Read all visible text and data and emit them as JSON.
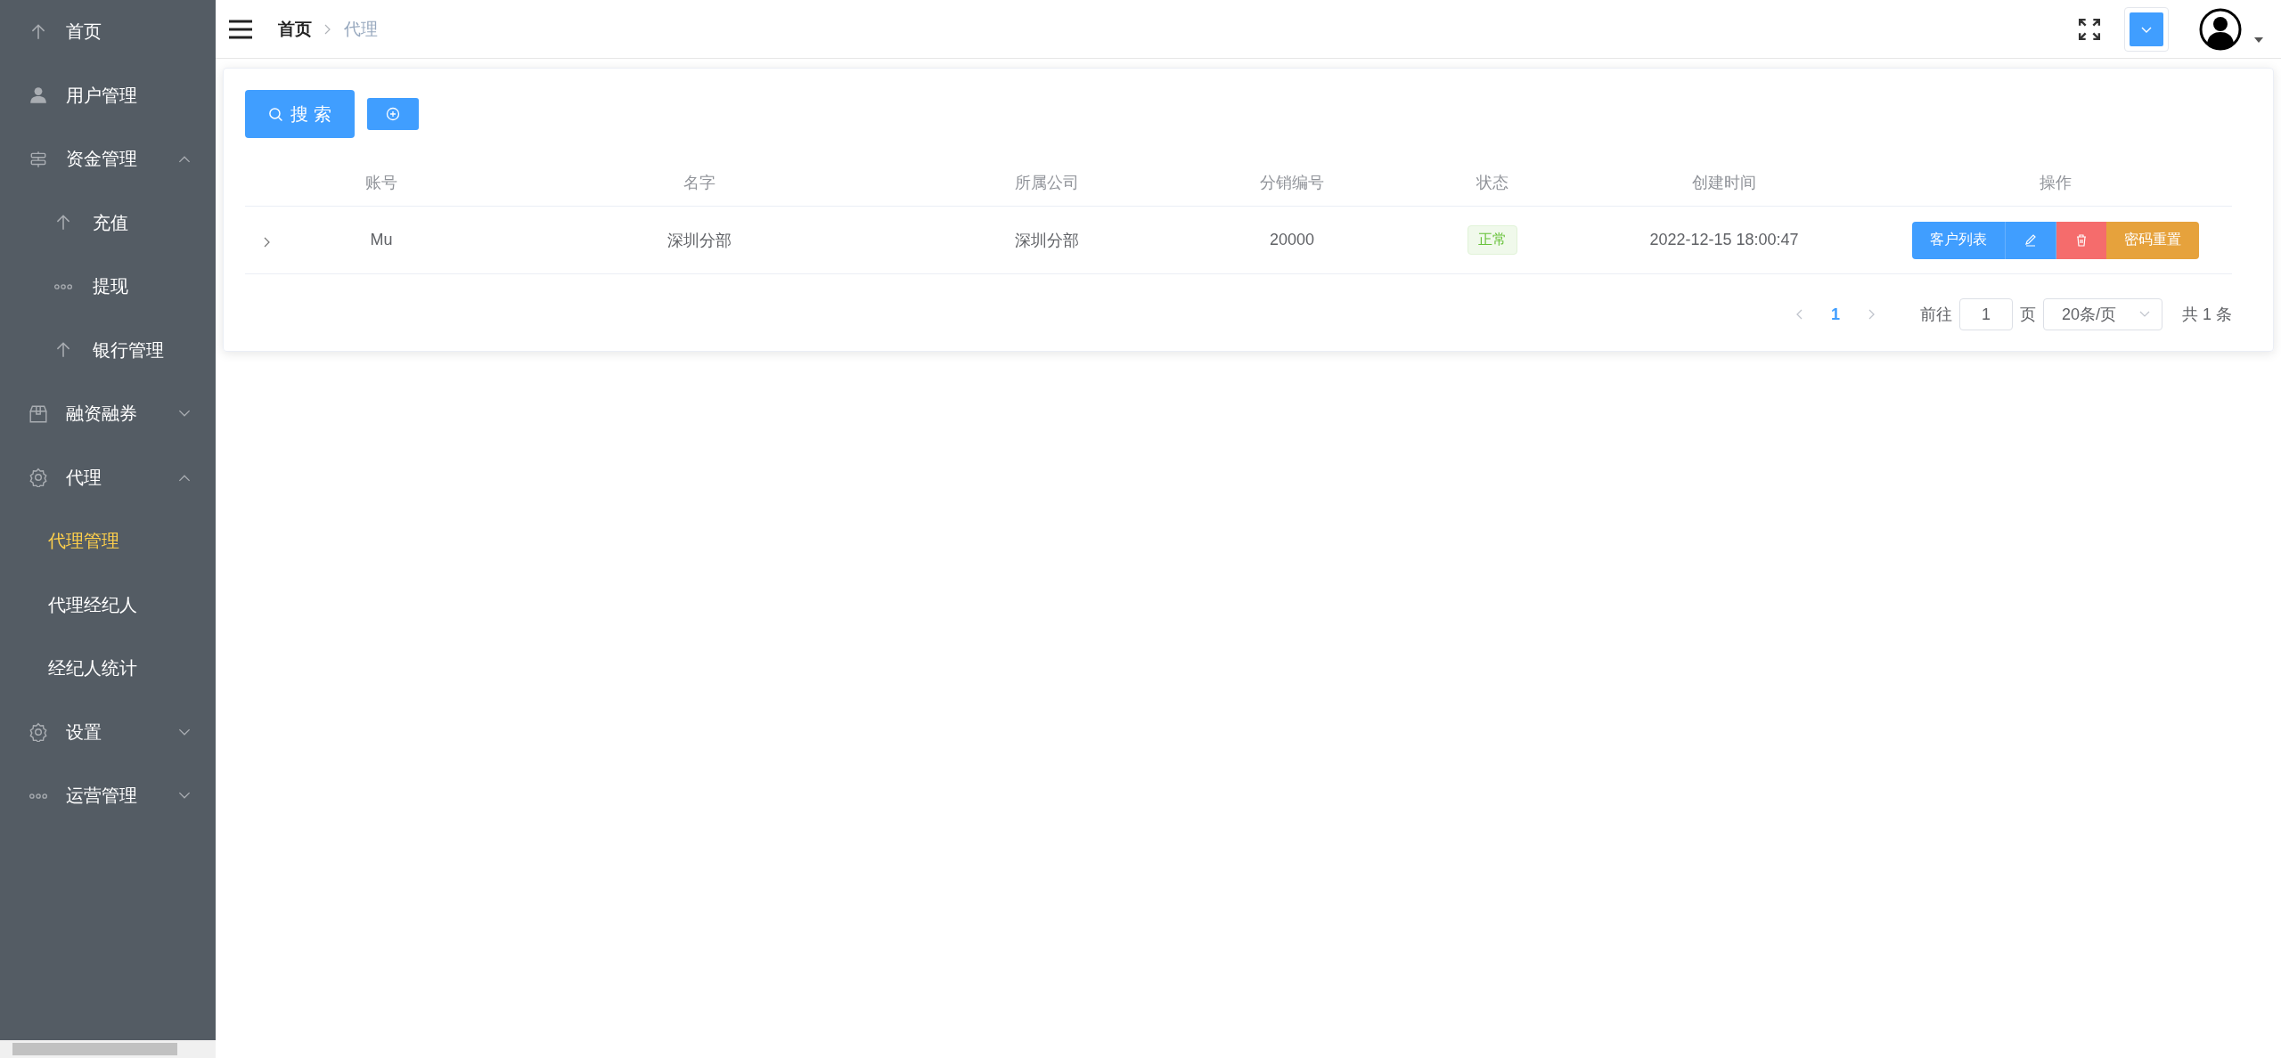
{
  "sidebar": {
    "items": [
      {
        "label": "首页",
        "kind": "item",
        "selected": false
      },
      {
        "label": "用户管理",
        "kind": "item",
        "selected": false
      },
      {
        "label": "资金管理",
        "kind": "submenu",
        "expanded": true,
        "selected": false,
        "children": [
          {
            "label": "充值",
            "selected": false
          },
          {
            "label": "提现",
            "selected": false
          },
          {
            "label": "银行管理",
            "selected": false
          }
        ]
      },
      {
        "label": "融资融券",
        "kind": "submenu",
        "expanded": false,
        "selected": false
      },
      {
        "label": "代理",
        "kind": "submenu",
        "expanded": true,
        "selected": false,
        "children": [
          {
            "label": "代理管理",
            "selected": true
          },
          {
            "label": "代理经纪人",
            "selected": false
          },
          {
            "label": "经纪人统计",
            "selected": false
          }
        ]
      },
      {
        "label": "设置",
        "kind": "submenu",
        "expanded": false,
        "selected": false
      },
      {
        "label": "运营管理",
        "kind": "submenu",
        "expanded": false,
        "selected": false
      }
    ]
  },
  "breadcrumb": [
    "首页",
    "代理"
  ],
  "toolbar": {
    "search_button": "搜 索"
  },
  "table": {
    "columns": [
      "账号",
      "名字",
      "所属公司",
      "分销编号",
      "状态",
      "创建时间",
      "操作"
    ],
    "rows": [
      {
        "expanded": false,
        "cells": [
          "Mu",
          "深圳分部",
          "深圳分部",
          "20000"
        ],
        "status": "正常",
        "created": "2022-12-15 18:00:47",
        "actions": [
          {
            "kind": "primary",
            "label": "客户列表"
          },
          {
            "kind": "edit"
          },
          {
            "kind": "delete"
          },
          {
            "kind": "warning",
            "label": "密码重置"
          }
        ]
      }
    ]
  },
  "pagination": {
    "pages": [
      {
        "label": "1",
        "selected": true
      }
    ],
    "goto_label": "前往",
    "goto_value": "1",
    "page_suffix": "页",
    "page_size": "20条/页",
    "total": "共 1 条"
  }
}
